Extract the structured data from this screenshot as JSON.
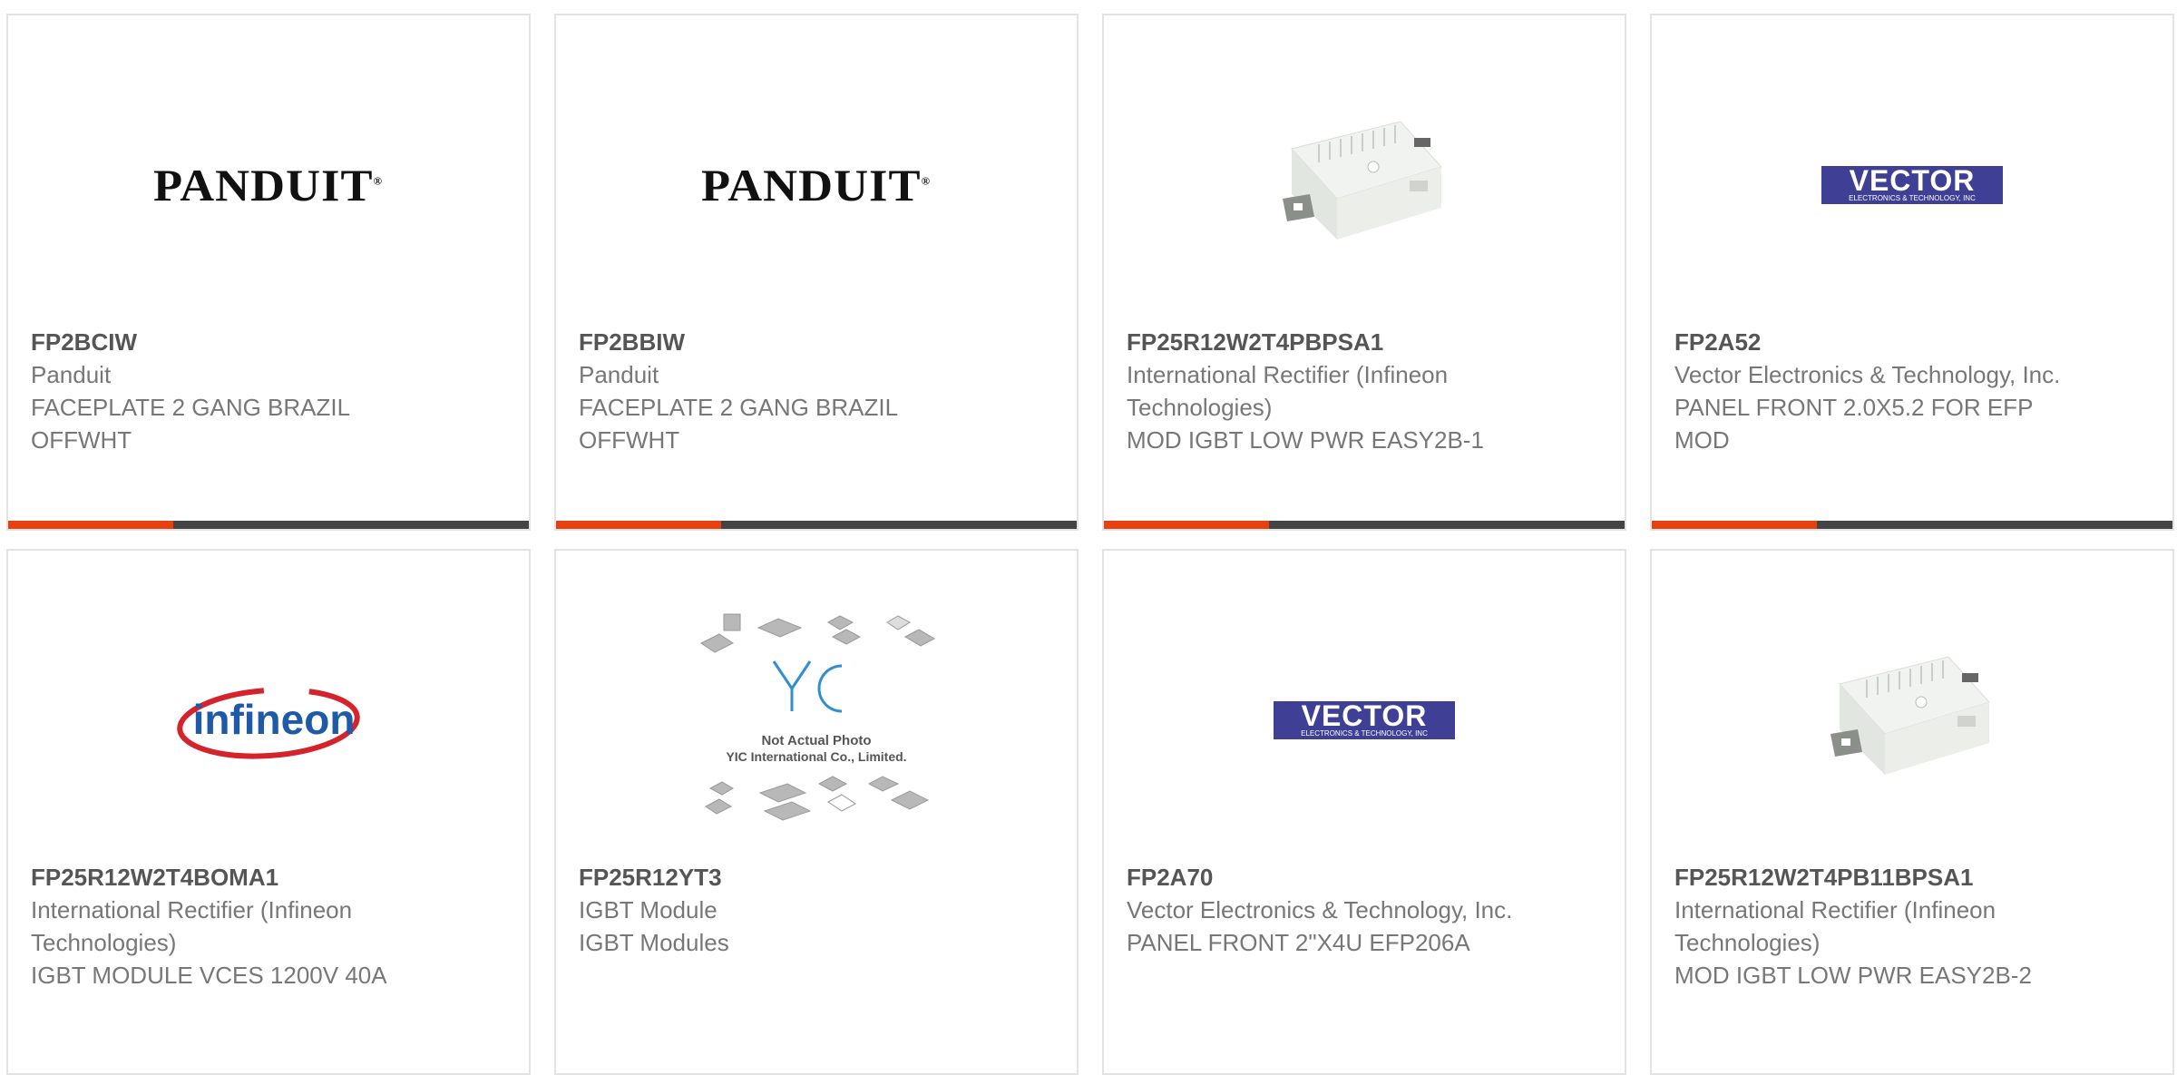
{
  "products": [
    {
      "part_number": "FP2BCIW",
      "manufacturer": "Panduit",
      "description": "FACEPLATE 2 GANG BRAZIL OFFWHT",
      "image": "panduit-logo"
    },
    {
      "part_number": "FP2BBIW",
      "manufacturer": "Panduit",
      "description": "FACEPLATE 2 GANG BRAZIL OFFWHT",
      "image": "panduit-logo"
    },
    {
      "part_number": "FP25R12W2T4PBPSA1",
      "manufacturer": "International Rectifier (Infineon Technologies)",
      "description": "MOD IGBT LOW PWR EASY2B-1",
      "image": "igbt-module-photo"
    },
    {
      "part_number": "FP2A52",
      "manufacturer": "Vector Electronics & Technology, Inc.",
      "description": "PANEL FRONT 2.0X5.2 FOR EFP MOD",
      "image": "vector-logo"
    },
    {
      "part_number": "FP25R12W2T4BOMA1",
      "manufacturer": "International Rectifier (Infineon Technologies)",
      "description": "IGBT MODULE VCES 1200V 40A",
      "image": "infineon-logo"
    },
    {
      "part_number": "FP25R12YT3",
      "manufacturer": "IGBT Module",
      "description": "IGBT Modules",
      "image": "yic-placeholder"
    },
    {
      "part_number": "FP2A70",
      "manufacturer": "Vector Electronics & Technology, Inc.",
      "description": "PANEL FRONT 2\"X4U EFP206A",
      "image": "vector-logo"
    },
    {
      "part_number": "FP25R12W2T4PB11BPSA1",
      "manufacturer": "International Rectifier (Infineon Technologies)",
      "description": "MOD IGBT LOW PWR EASY2B-2",
      "image": "igbt-module-photo"
    }
  ],
  "logos": {
    "panduit": "PANDUIT",
    "vector_big": "VECTOR",
    "vector_small": "ELECTRONICS & TECHNOLOGY, INC",
    "infineon": "infineon",
    "yic_line1": "Not Actual Photo",
    "yic_line2": "YIC International Co., Limited."
  },
  "colors": {
    "accent": "#e8410f",
    "bar_dark": "#444444",
    "border": "#e3e3e3",
    "infineon_red": "#d4232a",
    "infineon_blue": "#1e5aa8",
    "vector_blue": "#3f3f96"
  }
}
